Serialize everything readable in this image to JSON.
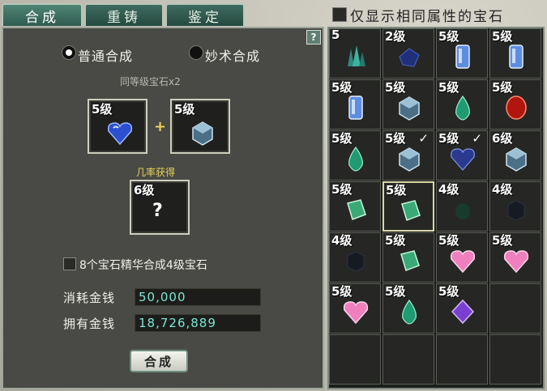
{
  "tabs": [
    {
      "label": "合成"
    },
    {
      "label": "重铸"
    },
    {
      "label": "鉴定"
    }
  ],
  "filter": {
    "label": "仅显示相同属性的宝石",
    "checked": false
  },
  "help": {
    "label": "?"
  },
  "modes": {
    "normal": {
      "label": "普通合成",
      "selected": true
    },
    "skill": {
      "label": "妙术合成",
      "selected": false
    }
  },
  "recipe_note": "同等级宝石x2",
  "inputs": [
    {
      "level": "5级",
      "gem": "blue-heart-gem-icon"
    },
    {
      "level": "5级",
      "gem": "silver-cube-gem-icon"
    }
  ],
  "plus": "+",
  "result_note": "几率获得",
  "result": {
    "level": "6级",
    "symbol": "?"
  },
  "essence_option": {
    "label": "8个宝石精华合成4级宝石",
    "checked": false
  },
  "cost": {
    "label": "消耗金钱",
    "value": "50,000"
  },
  "owned": {
    "label": "拥有金钱",
    "value": "18,726,889"
  },
  "compose_button": "合成",
  "grid": [
    {
      "level": "5",
      "gem": "teal-crystal-cluster-icon",
      "checked": false,
      "selected": false
    },
    {
      "level": "2级",
      "gem": "dark-blue-gem-icon",
      "checked": false,
      "selected": false
    },
    {
      "level": "5级",
      "gem": "pale-blue-crystal-icon",
      "checked": false,
      "selected": false
    },
    {
      "level": "5级",
      "gem": "pale-blue-crystal-icon",
      "checked": false,
      "selected": false
    },
    {
      "level": "5级",
      "gem": "pale-blue-crystal-icon",
      "checked": false,
      "selected": false
    },
    {
      "level": "5级",
      "gem": "silver-cube-gem-icon",
      "checked": false,
      "selected": false
    },
    {
      "level": "5级",
      "gem": "green-drop-gem-icon",
      "checked": false,
      "selected": false
    },
    {
      "level": "5级",
      "gem": "red-oval-gem-icon",
      "checked": false,
      "selected": false
    },
    {
      "level": "5级",
      "gem": "green-drop-gem-icon",
      "checked": false,
      "selected": false
    },
    {
      "level": "5级",
      "gem": "silver-cube-gem-icon",
      "checked": true,
      "selected": false
    },
    {
      "level": "5级",
      "gem": "blue-heart-gem-icon",
      "checked": true,
      "selected": false
    },
    {
      "level": "6级",
      "gem": "silver-cube-gem-icon",
      "checked": false,
      "selected": false
    },
    {
      "level": "5级",
      "gem": "green-block-gem-icon",
      "checked": false,
      "selected": false
    },
    {
      "level": "5级",
      "gem": "green-block-gem-icon",
      "checked": false,
      "selected": true
    },
    {
      "level": "4级",
      "gem": "dark-green-gem-icon",
      "checked": false,
      "selected": false
    },
    {
      "level": "4级",
      "gem": "dark-cube-gem-icon",
      "checked": false,
      "selected": false
    },
    {
      "level": "4级",
      "gem": "dark-cube-gem-icon",
      "checked": false,
      "selected": false
    },
    {
      "level": "5级",
      "gem": "green-block-gem-icon",
      "checked": false,
      "selected": false
    },
    {
      "level": "5级",
      "gem": "pink-heart-gem-icon",
      "checked": false,
      "selected": false
    },
    {
      "level": "5级",
      "gem": "pink-heart-gem-icon",
      "checked": false,
      "selected": false
    },
    {
      "level": "5级",
      "gem": "pink-heart-gem-icon",
      "checked": false,
      "selected": false
    },
    {
      "level": "5级",
      "gem": "green-drop-gem-icon",
      "checked": false,
      "selected": false
    },
    {
      "level": "5级",
      "gem": "purple-diamond-gem-icon",
      "checked": false,
      "selected": false
    },
    {
      "level": "",
      "gem": "",
      "checked": false,
      "selected": false
    },
    {
      "level": "",
      "gem": "",
      "checked": false,
      "selected": false
    },
    {
      "level": "",
      "gem": "",
      "checked": false,
      "selected": false
    },
    {
      "level": "",
      "gem": "",
      "checked": false,
      "selected": false
    },
    {
      "level": "",
      "gem": "",
      "checked": false,
      "selected": false
    }
  ],
  "colors": {
    "panel": "#494a45",
    "tab": "#2f5c50",
    "money_text": "#7de6d5",
    "note_gray": "#b8b8b0",
    "note_yellow": "#e8d25a"
  }
}
